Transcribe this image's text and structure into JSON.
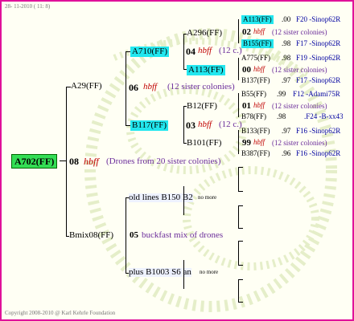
{
  "header": {
    "date": "28- 11-2010 ( 11:  8)"
  },
  "footer": {
    "copyright": "Copyright 2008-2010 @ Karl Kehrle Foundation"
  },
  "colors": {
    "border": "#e0119a",
    "highlight_cyan": "#22e7ef",
    "highlight_green": "#33dd55"
  },
  "root": {
    "name": "A702(FF)",
    "num": "08",
    "hbff": "hbff",
    "desc": "(Drones from 20 sister colonies)"
  },
  "upper": {
    "name": "A29(FF)",
    "num": "06",
    "hbff": "hbff",
    "desc": "(12 sister colonies)",
    "a710": {
      "name": "A710(FF)",
      "num": "04",
      "hbff": "hbff",
      "desc": "(12 c.)",
      "a296": {
        "name": "A296(FF)",
        "num": "02",
        "hbff": "hbff",
        "desc": "(12 sister colonies)",
        "top": {
          "name": "A113(FF)",
          "score": ".00",
          "info": "F20 -Sinop62R"
        },
        "bot": {
          "name": "B155(FF)",
          "score": ".98",
          "info": "F17 -Sinop62R"
        }
      },
      "a113": {
        "name": "A113(FF)",
        "num": "00",
        "hbff": "hbff",
        "desc": "(12 sister colonies)",
        "top": {
          "name": "A775(FF)",
          "score": ".98",
          "info": "F19 -Sinop62R"
        },
        "bot": {
          "name": "B137(FF)",
          "score": ".97",
          "info": "F17 -Sinop62R"
        }
      }
    },
    "b117": {
      "name": "B117(FF)",
      "num": "03",
      "hbff": "hbff",
      "desc": "(12 c.)",
      "b12": {
        "name": "B12(FF)",
        "num": "01",
        "hbff": "hbff",
        "desc": "(12 sister colonies)",
        "top": {
          "name": "B55(FF)",
          "score": ".99",
          "info": "F12 -Adami75R"
        },
        "bot": {
          "name": "B78(FF)",
          "score": ".98",
          "info": ".F24 -B-xx43"
        }
      },
      "b101": {
        "name": "B101(FF)",
        "num": "99",
        "hbff": "hbff",
        "desc": "(12 sister colonies)",
        "top": {
          "name": "B133(FF)",
          "score": ".97",
          "info": "F16 -Sinop62R"
        },
        "bot": {
          "name": "B387(FF)",
          "score": ".96",
          "info": "F16 -Sinop62R"
        }
      }
    }
  },
  "lower": {
    "name": "Bmix08(FF)",
    "num": "05",
    "desc": "buckfast mix of drones",
    "old": {
      "label": "old lines B150 B2",
      "more": "no more"
    },
    "plus": {
      "label": "plus B1003 S6 an",
      "more": "no more"
    }
  }
}
